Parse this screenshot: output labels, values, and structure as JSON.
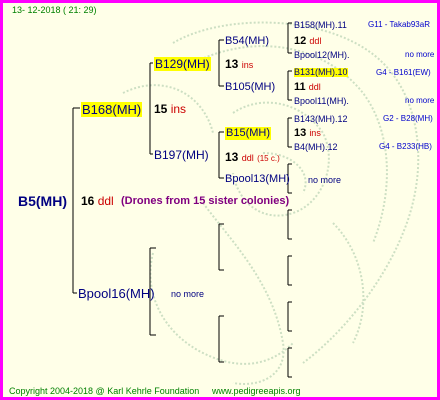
{
  "header": {
    "timestamp": "13- 12-2018 ( 21: 29)"
  },
  "footer": {
    "copyright": "Copyright 2004-2018 @ Karl Kehrle Foundation",
    "website": "www.pedigreeapis.org"
  },
  "root": {
    "label": "B5(MH)",
    "count": "16",
    "suffix": "ddl",
    "note": "(Drones from 15 sister colonies)"
  },
  "gen1": {
    "top": {
      "label": "B168(MH)",
      "count": "15",
      "suffix": "ins"
    },
    "bottom": {
      "label": "Bpool16(MH)",
      "note": "no more"
    }
  },
  "gen2": {
    "a": {
      "label": "B129(MH)",
      "count": "13",
      "suffix": "ins"
    },
    "b": {
      "label": "B197(MH)",
      "count": "13",
      "suffix": "ddl",
      "extra": "(15 c.)"
    }
  },
  "gen3": {
    "a": {
      "label": "B54(MH)",
      "count": "12",
      "suffix": "ddl"
    },
    "b": {
      "label": "B105(MH)",
      "count": "11",
      "suffix": "ddl"
    },
    "c": {
      "label": "B15(MH)",
      "count": "13",
      "suffix": "ins"
    },
    "d": {
      "label": "Bpool13(MH)",
      "note": "no more"
    }
  },
  "gen4": [
    {
      "label": "B158(MH).11",
      "info": "G11 - Takab93aR"
    },
    {
      "label": "Bpool12(MH).",
      "info": "no more"
    },
    {
      "label": "B131(MH).10",
      "info": "G4 - B161(EW)"
    },
    {
      "label": "Bpool11(MH).",
      "info": "no more"
    },
    {
      "label": "B143(MH).12",
      "info": "G2 - B28(MH)"
    },
    {
      "label": "B4(MH).12",
      "info": "G4 - B233(HB)"
    }
  ]
}
